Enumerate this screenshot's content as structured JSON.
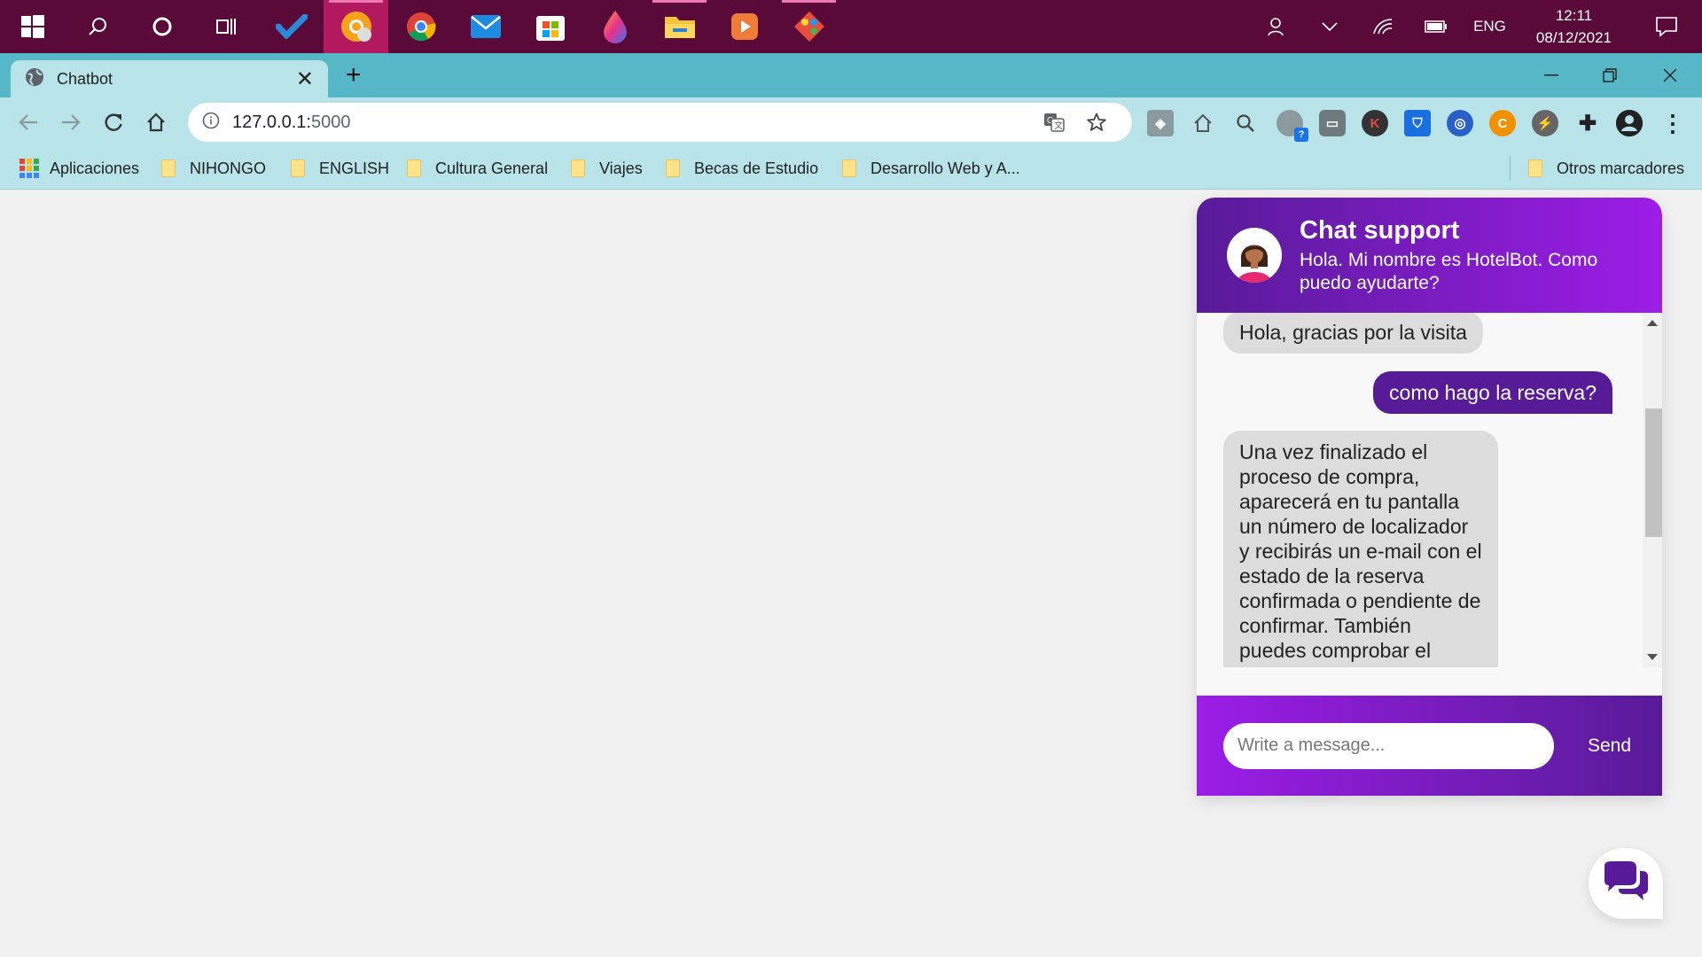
{
  "taskbar": {
    "apps": [
      "start-icon",
      "search-icon",
      "cortana-icon",
      "task-view-icon",
      "todo-icon",
      "chrome-canary-icon",
      "chrome-icon",
      "mail-icon",
      "store-icon",
      "paint-drop-icon",
      "file-explorer-icon",
      "media-player-icon",
      "sourcetree-icon"
    ],
    "language": "ENG",
    "time": "12:11",
    "date": "08/12/2021"
  },
  "browser": {
    "tab_title": "Chatbot",
    "url_host": "127.0.0.1:",
    "url_port": "5000",
    "bookmarks": {
      "apps": "Aplicaciones",
      "items": [
        "NIHONGO",
        "ENGLISH",
        "Cultura General",
        "Viajes",
        "Becas de Estudio",
        "Desarrollo Web y A..."
      ],
      "other": "Otros marcadores"
    }
  },
  "chat": {
    "title": "Chat support",
    "description": "Hola. Mi nombre es HotelBot. Como puedo ayudarte?",
    "messages": [
      {
        "sender": "bot",
        "text": "Hola, gracias por la visita"
      },
      {
        "sender": "user",
        "text": "como hago la reserva?"
      },
      {
        "sender": "bot",
        "text": "Una vez finalizado el proceso de compra, aparecerá en tu pantalla un número de localizador y recibirás un e-mail con el estado de la reserva confirmada o pendiente de confirmar. También puedes comprobar el"
      }
    ],
    "input_placeholder": "Write a message...",
    "send_label": "Send"
  },
  "colors": {
    "taskbar": "#5a0a39",
    "tab_strip": "#56b7c6",
    "toolbar": "#b7e3e9",
    "chat_primary": "#581b98",
    "chat_secondary": "#9c1de7"
  }
}
